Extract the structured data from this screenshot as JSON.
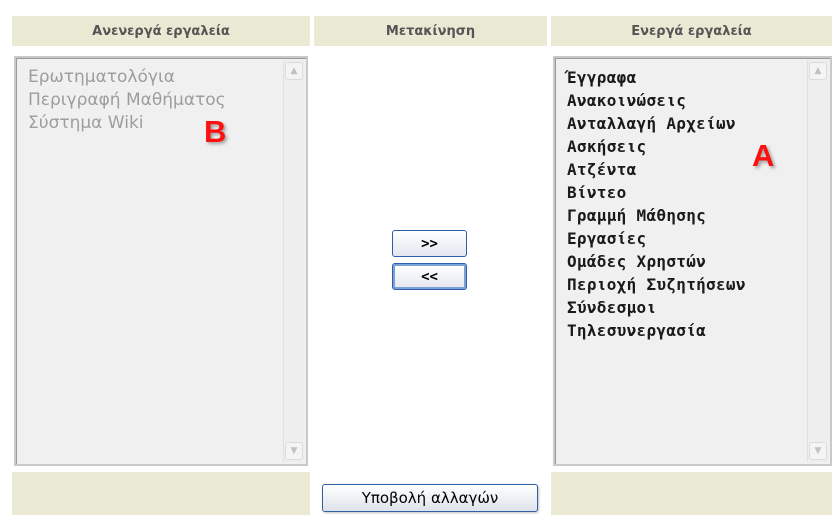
{
  "headers": {
    "inactive": "Ανενεργά εργαλεία",
    "move": "Μετακίνηση",
    "active": "Ενεργά εργαλεία"
  },
  "inactive_tools": [
    "Ερωτηματολόγια",
    "Περιγραφή Μαθήματος",
    "Σύστημα Wiki"
  ],
  "active_tools": [
    "Έγγραφα",
    "Ανακοινώσεις",
    "Ανταλλαγή Αρχείων",
    "Ασκήσεις",
    "Ατζέντα",
    "Βίντεο",
    "Γραμμή Μάθησης",
    "Εργασίες",
    "Ομάδες Χρηστών",
    "Περιοχή Συζητήσεων",
    "Σύνδεσμοι",
    "Τηλεσυνεργασία"
  ],
  "annotations": {
    "left": "B",
    "right": "A"
  },
  "buttons": {
    "add": ">>",
    "remove": "<<",
    "submit": "Υποβολή αλλαγών"
  },
  "scroll_icons": {
    "up": "chevron-up-icon",
    "down": "chevron-down-icon"
  },
  "colors": {
    "header_bg": "#e9e9d4",
    "annotation": "#ff1010",
    "button_border": "#2f5fa6"
  }
}
